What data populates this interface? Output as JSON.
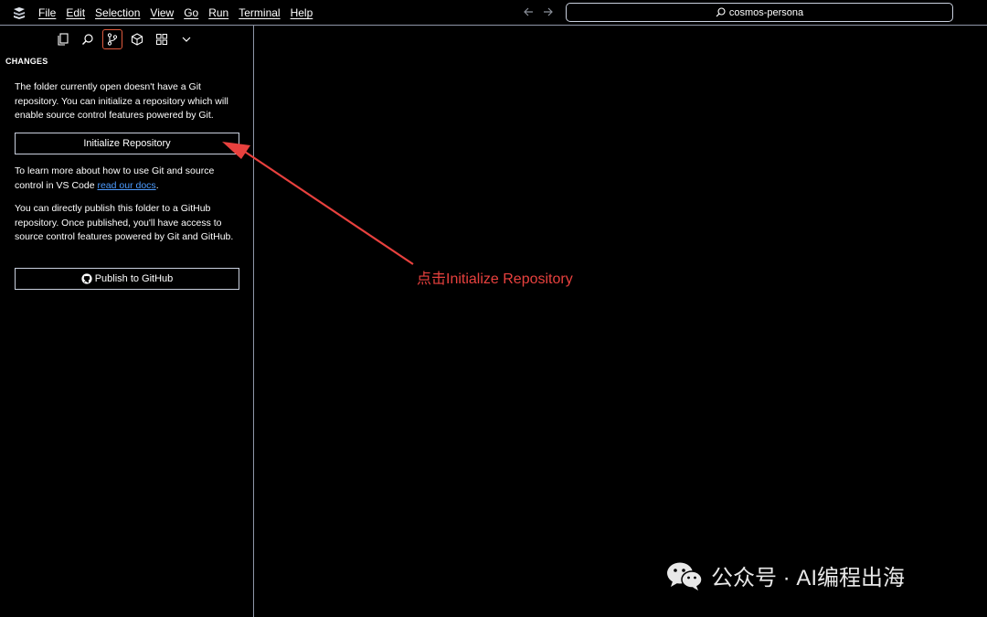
{
  "menu": {
    "items": [
      "File",
      "Edit",
      "Selection",
      "View",
      "Go",
      "Run",
      "Terminal",
      "Help"
    ]
  },
  "command_center": {
    "text": "cosmos-persona"
  },
  "activity_bar": {
    "icons": [
      "explorer-icon",
      "search-icon",
      "source-control-icon",
      "extensions-icon",
      "remote-explorer-icon",
      "chevron-down-icon"
    ],
    "active": "source-control-icon"
  },
  "sidebar": {
    "title": "CHANGES",
    "intro": "The folder currently open doesn't have a Git repository. You can initialize a repository which will enable source control features powered by Git.",
    "init_button": "Initialize Repository",
    "learn_prefix": "To learn more about how to use Git and source control in VS Code ",
    "learn_link": "read our docs",
    "learn_suffix": ".",
    "publish_text": "You can directly publish this folder to a GitHub repository. Once published, you'll have access to source control features powered by Git and GitHub.",
    "publish_button": "Publish to GitHub"
  },
  "annotation": {
    "text": "点击Initialize Repository",
    "color": "#e8413e"
  },
  "watermark": {
    "text": "公众号 · AI编程出海"
  },
  "colors": {
    "background": "#000000",
    "border": "#8f96a8",
    "link": "#4d9cff",
    "active_outline": "#e05a3d"
  }
}
